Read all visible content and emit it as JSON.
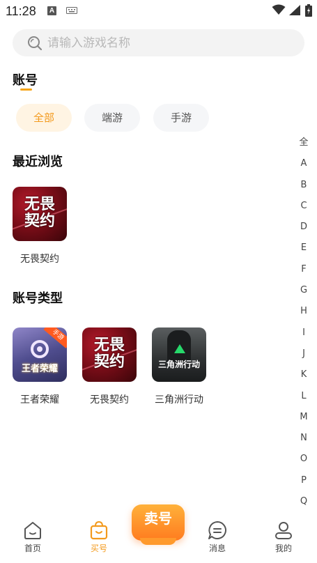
{
  "status_bar": {
    "time": "11:28",
    "notification_icon": "A"
  },
  "search": {
    "placeholder": "请输入游戏名称"
  },
  "account_section": {
    "title": "账号",
    "filters": [
      {
        "label": "全部",
        "active": true
      },
      {
        "label": "端游",
        "active": false
      },
      {
        "label": "手游",
        "active": false
      }
    ]
  },
  "recent_section": {
    "title": "最近浏览",
    "games": [
      {
        "name": "无畏契约",
        "logo": "无畏\n契约",
        "icon": "wuwei-icon"
      }
    ]
  },
  "types_section": {
    "title": "账号类型",
    "games": [
      {
        "name": "王者荣耀",
        "logo": "王者荣耀",
        "badge": "手游",
        "icon": "wangzhe-icon"
      },
      {
        "name": "无畏契约",
        "logo": "无畏\n契约",
        "icon": "wuwei-icon"
      },
      {
        "name": "三角洲行动",
        "logo": "三角洲行动",
        "icon": "delta-icon"
      }
    ]
  },
  "alpha_index": [
    "全",
    "A",
    "B",
    "C",
    "D",
    "E",
    "F",
    "G",
    "H",
    "I",
    "J",
    "K",
    "L",
    "M",
    "N",
    "O",
    "P",
    "Q"
  ],
  "tab_bar": {
    "tabs": [
      {
        "label": "首页",
        "icon": "home-icon",
        "active": false
      },
      {
        "label": "买号",
        "icon": "shopping-bag-icon",
        "active": true
      },
      {
        "label": "消息",
        "icon": "message-icon",
        "active": false
      },
      {
        "label": "我的",
        "icon": "profile-icon",
        "active": false
      }
    ],
    "sell_label": "卖号"
  },
  "colors": {
    "accent": "#f39a1d",
    "chip_active_bg": "#fff4e3",
    "chip_bg": "#f5f6f8",
    "search_bg": "#f3f3f3"
  }
}
